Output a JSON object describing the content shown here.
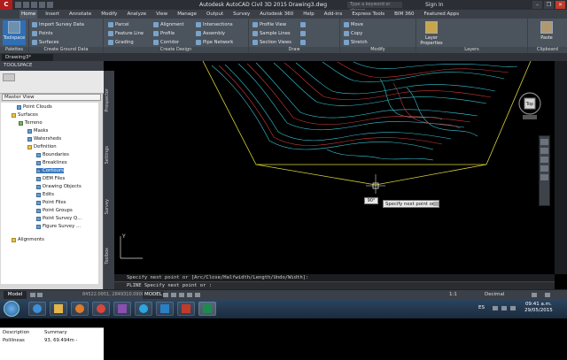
{
  "title_bar": {
    "app_logo": "C",
    "title": "Autodesk AutoCAD Civil 3D 2015   Drawing3.dwg",
    "search_placeholder": "Type a keyword or phrase",
    "sign_in": "Sign In"
  },
  "ribbon_tabs": [
    "Home",
    "Insert",
    "Annotate",
    "Modify",
    "Analyze",
    "View",
    "Manage",
    "Output",
    "Survey",
    "Autodesk 360",
    "Help",
    "Add-ins",
    "Express Tools",
    "BIM 360",
    "Featured Apps"
  ],
  "ribbon": {
    "toolspace": "Toolspace",
    "palettes_label": "Palettes",
    "ground_items": [
      "Import Survey Data",
      "Points",
      "Surfaces"
    ],
    "ground_label": "Create Ground Data",
    "design_items": [
      "Parcel",
      "Feature Line",
      "Grading",
      "Alignment",
      "Profile",
      "Corridor",
      "Intersections",
      "Assembly",
      "Pipe Network"
    ],
    "design_label": "Create Design",
    "draw_items": [
      "Profile View",
      "Sample Lines",
      "Section Views"
    ],
    "draw_label": "Draw",
    "modify_items": [
      "Move",
      "Copy",
      "Stretch"
    ],
    "modify_label": "Modify",
    "layers_btn": "Layer Properties",
    "layers_label": "Layers",
    "paste_btn": "Paste",
    "clipboard_label": "Clipboard"
  },
  "document_tab": "Drawing3*",
  "toolspace_panel": {
    "header": "TOOLSPACE",
    "view": "Master View",
    "tree": [
      "Point Clouds",
      "Surfaces",
      "Terreno",
      "Masks",
      "Watersheds",
      "Definition",
      "Boundaries",
      "Breaklines",
      "Contours",
      "DEM Files",
      "Drawing Objects",
      "Edits",
      "Point Files",
      "Point Groups",
      "Point Survey Q...",
      "Figure Survey ...",
      "Alignments"
    ],
    "vertical_tabs": [
      "Prospector",
      "Settings",
      "Survey",
      "Toolbox"
    ],
    "grid_headers": [
      "Description",
      "Summary"
    ],
    "grid_row": [
      "Polilineas",
      "93, 69.494m -"
    ]
  },
  "canvas": {
    "tooltip": "Specify next point or",
    "angle": "90°",
    "viewcube_face": "Top",
    "ucs": "Y"
  },
  "command": {
    "history": "Specify next point or [Arc/Close/Halfwidth/Length/Undo/Width]:",
    "prompt": "PLINE Specify next point or :"
  },
  "statusbar": {
    "model_tab": "Model",
    "coords": "84522.0951, 2849310.0900, 0.0000",
    "model": "MODEL",
    "scale": "1:1",
    "units": "Decimal"
  },
  "taskbar": {
    "language": "ES",
    "time": "09:41 a.m.",
    "date": "29/05/2015"
  }
}
